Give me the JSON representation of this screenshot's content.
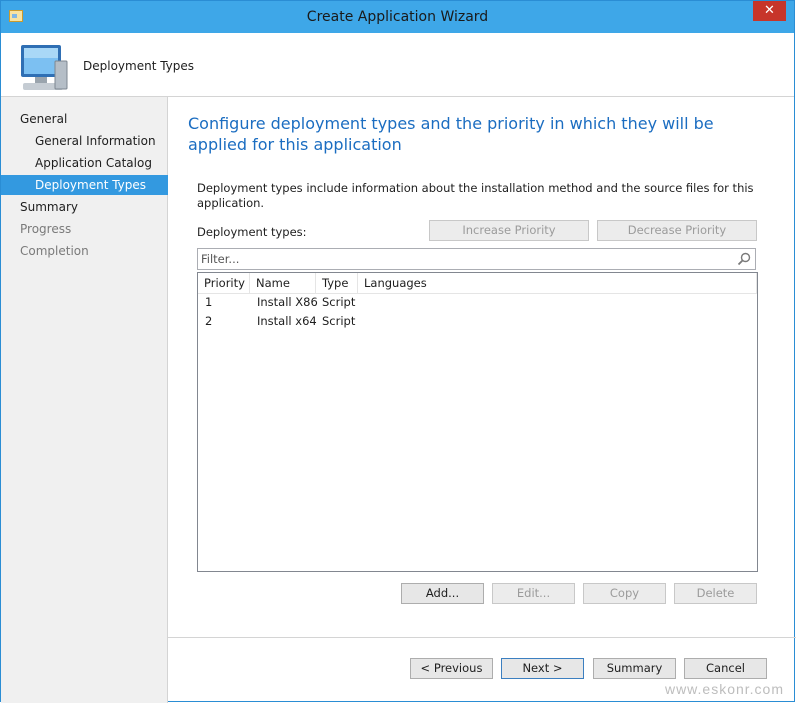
{
  "window": {
    "title": "Create Application Wizard",
    "close_glyph": "✕"
  },
  "header": {
    "page_title": "Deployment Types",
    "icon": "monitor-icon"
  },
  "sidebar": {
    "items": [
      {
        "label": "General",
        "level": "top",
        "state": "normal"
      },
      {
        "label": "General Information",
        "level": "sub",
        "state": "normal"
      },
      {
        "label": "Application Catalog",
        "level": "sub",
        "state": "normal"
      },
      {
        "label": "Deployment Types",
        "level": "sub",
        "state": "selected"
      },
      {
        "label": "Summary",
        "level": "top",
        "state": "normal"
      },
      {
        "label": "Progress",
        "level": "top",
        "state": "disabled"
      },
      {
        "label": "Completion",
        "level": "top",
        "state": "disabled"
      }
    ]
  },
  "main": {
    "heading": "Configure deployment types and the priority in which they will be applied for this application",
    "description": "Deployment types include information about the installation method and the source files for this application.",
    "types_label": "Deployment types:",
    "increase_priority": "Increase Priority",
    "decrease_priority": "Decrease Priority",
    "filter_placeholder": "Filter...",
    "table": {
      "columns": [
        "Priority",
        "Name",
        "Type",
        "Languages"
      ],
      "rows": [
        {
          "priority": "1",
          "name": "Install X86",
          "type": "Script",
          "languages": ""
        },
        {
          "priority": "2",
          "name": "Install x64",
          "type": "Script",
          "languages": ""
        }
      ]
    },
    "add": "Add...",
    "edit": "Edit...",
    "copy": "Copy",
    "delete": "Delete"
  },
  "footer": {
    "previous": "< Previous",
    "next": "Next >",
    "summary": "Summary",
    "cancel": "Cancel"
  },
  "watermark": "www.eskonr.com",
  "colors": {
    "titlebar": "#3ea7e8",
    "selected": "#3399e0",
    "heading": "#1b6dc1"
  }
}
